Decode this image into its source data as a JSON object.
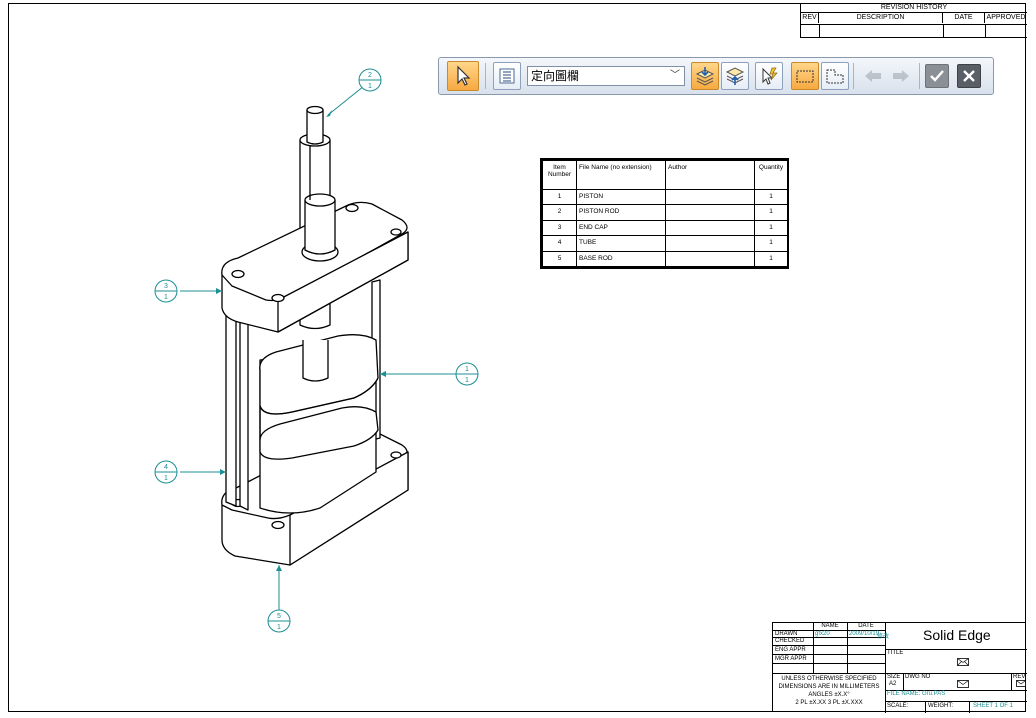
{
  "toolbar": {
    "dropdown_value": "定向圖欄",
    "buttons": [
      {
        "name": "select-arrow-icon"
      },
      {
        "name": "list-properties-icon"
      },
      {
        "name": "dropdown-chevron-icon"
      },
      {
        "name": "stack-down-icon"
      },
      {
        "name": "stack-up-icon"
      },
      {
        "name": "smart-select-icon"
      },
      {
        "name": "rectangle-icon"
      },
      {
        "name": "corner-shape-icon"
      },
      {
        "name": "arrow-left-icon"
      },
      {
        "name": "arrow-right-icon"
      },
      {
        "name": "check-icon"
      },
      {
        "name": "close-icon"
      }
    ],
    "accent": "#f7a940"
  },
  "revision_history": {
    "title": "REVISION HISTORY",
    "headers": [
      "REV",
      "DESCRIPTION",
      "DATE",
      "APPROVED"
    ]
  },
  "parts_list": {
    "headers": [
      "Item Number",
      "File Name (no extension)",
      "Author",
      "Quantity"
    ],
    "rows": [
      [
        "1",
        "PISTON",
        "",
        "1"
      ],
      [
        "2",
        "PISTON ROD",
        "",
        "1"
      ],
      [
        "3",
        "END CAP",
        "",
        "1"
      ],
      [
        "4",
        "TUBE",
        "",
        "1"
      ],
      [
        "5",
        "BASE ROD",
        "",
        "1"
      ]
    ]
  },
  "balloons": [
    {
      "top": "2",
      "bottom": "1"
    },
    {
      "top": "3",
      "bottom": "1"
    },
    {
      "top": "1",
      "bottom": "1"
    },
    {
      "top": "4",
      "bottom": "1"
    },
    {
      "top": "5",
      "bottom": "1"
    }
  ],
  "title_block": {
    "col_name": "NAME",
    "col_date": "DATE",
    "drawn": "DRAWN",
    "checked": "CHECKED",
    "eng_appr": "ENG APPR",
    "mgr_appr": "MGR APPR",
    "drawn_name": "gfx20",
    "drawn_date": "2009/10/19",
    "drawn_extra": "修改",
    "brand": "Solid Edge",
    "title_label": "TITLE",
    "notes": [
      "UNLESS OTHERWISE SPECIFIED",
      "DIMENSIONS ARE IN MILLIMETERS",
      "ANGLES ±X.X°",
      "2 PL ±X.XX 3 PL ±X.XXX"
    ],
    "size_label": "SIZE",
    "size_value": "A2",
    "dwg_no_label": "DWG NO",
    "rev_label": "REV",
    "file_name": "FILE NAME: Gru.PAS",
    "scale": "SCALE:",
    "weight": "WEIGHT:",
    "sheet": "SHEET 1 OF 1"
  },
  "colors": {
    "leader": "#1b8f93",
    "line": "#000000"
  }
}
